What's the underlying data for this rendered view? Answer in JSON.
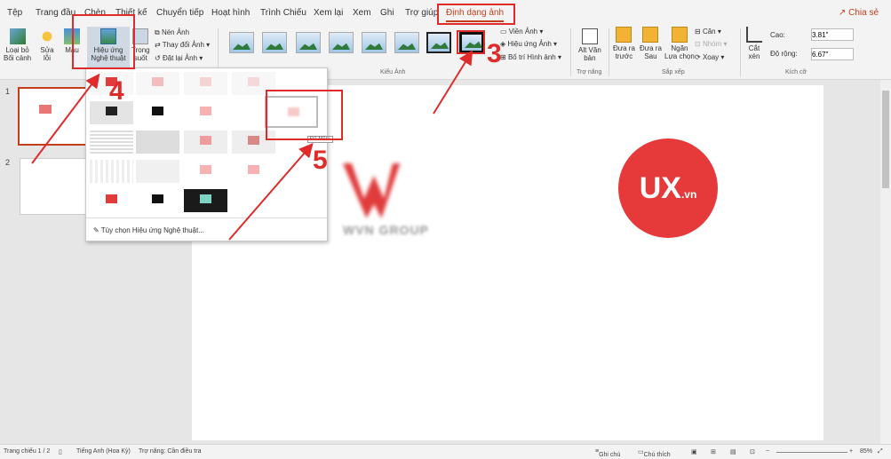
{
  "tabs": [
    "Tệp",
    "Trang đầu",
    "Chèn",
    "Thiết kế",
    "Chuyển tiếp",
    "Hoạt hình",
    "Trình Chiếu",
    "Xem lại",
    "Xem",
    "Ghi",
    "Trợ giúp",
    "Định dạng ảnh"
  ],
  "share_label": "Chia sẻ",
  "ribbon": {
    "remove_bg": [
      "Loại bỏ",
      "Bối cảnh"
    ],
    "corrections": [
      "Sửa",
      "lỗi"
    ],
    "color": "Màu",
    "artistic_effects": [
      "Hiệu ứng",
      "Nghệ thuật"
    ],
    "transparency": [
      "Trong",
      "suốt"
    ],
    "compress": "Nén Ảnh",
    "change_picture": "Thay đổi Ảnh",
    "reset_picture": "Đặt lại Ảnh",
    "group_styles": "Kiểu Ảnh",
    "border": "Viền Ảnh",
    "effects": "Hiệu ứng Ảnh",
    "layout": "Bố trí Hình ảnh",
    "alt_text": [
      "Alt Văn",
      "bản"
    ],
    "group_access": "Trợ năng",
    "bring_forward": [
      "Đưa ra",
      "trước"
    ],
    "send_backward": [
      "Đưa ra",
      "Sau"
    ],
    "selection_pane": [
      "Ngăn",
      "Lựa chọn"
    ],
    "align": "Căn",
    "group": "Nhóm",
    "rotate": "Xoay",
    "group_arrange": "Sắp xếp",
    "crop": [
      "Cắt",
      "xén"
    ],
    "height_label": "Cao:",
    "height_value": "3.81\"",
    "width_label": "Độ rộng:",
    "width_value": "6.67\"",
    "group_size": "Kích cỡ"
  },
  "gallery": {
    "tooltip": "Đề Mềm",
    "option": "Tùy chọn Hiệu ứng Nghệ thuật..."
  },
  "slides": [
    "1",
    "2"
  ],
  "canvas": {
    "logo_text": "WVN GROUP",
    "ux_text": "UX",
    "ux_suffix": ".vn"
  },
  "annotations": [
    "4",
    "3",
    "5"
  ],
  "status": {
    "slide": "Trang chiếu 1 / 2",
    "language": "Tiếng Anh (Hoa Kỳ)",
    "accessibility": "Trợ năng: Cần điều tra",
    "notes": "Ghi chú",
    "comments": "Chú thích",
    "zoom": "85%"
  },
  "colors": {
    "accent": "#c43e1c",
    "annotation": "#e02b2b",
    "ux_circle": "#e63a3a"
  }
}
